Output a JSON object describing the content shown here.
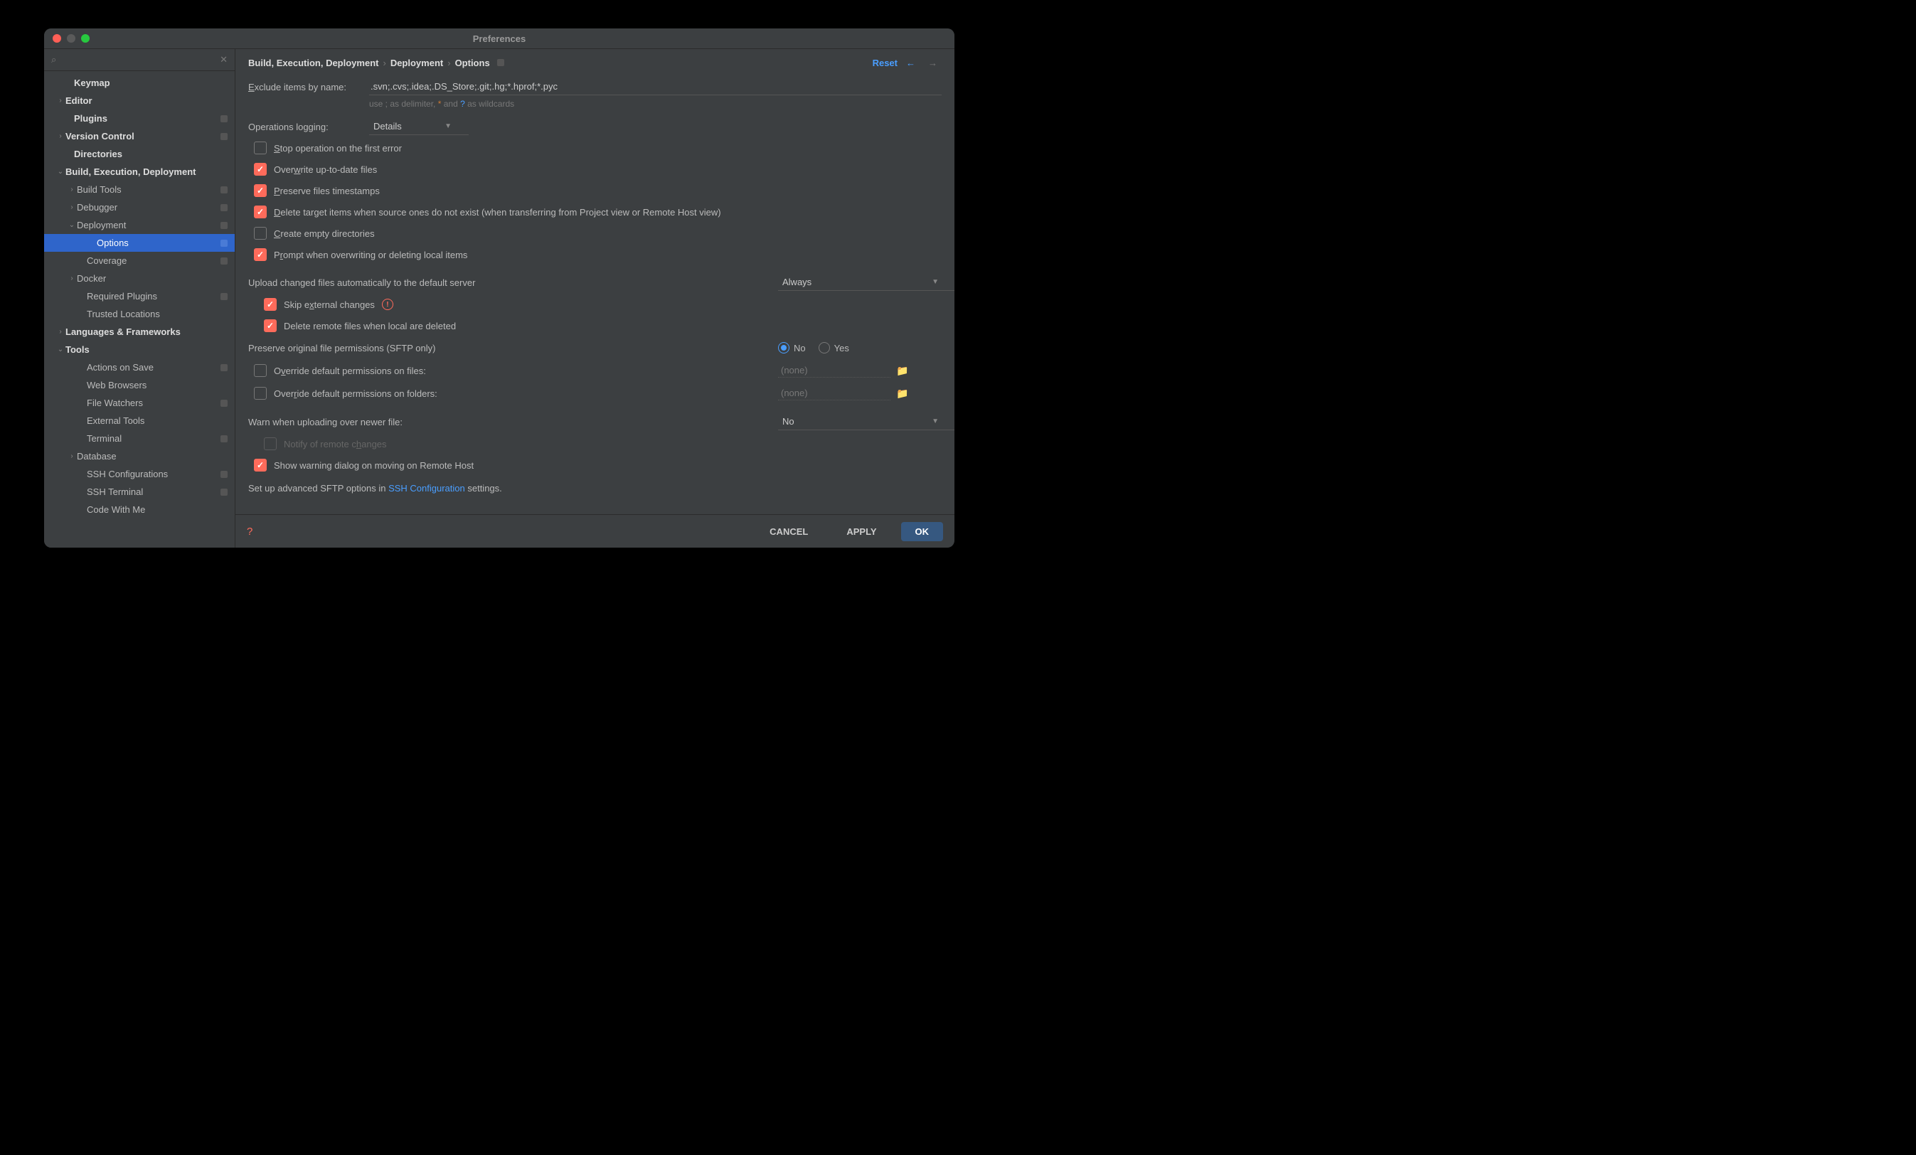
{
  "window_title": "Preferences",
  "search_placeholder": "",
  "sidebar": [
    {
      "label": "Keymap",
      "indent": 28,
      "bold": true,
      "arrow": "",
      "badge": false
    },
    {
      "label": "Editor",
      "indent": 16,
      "bold": true,
      "arrow": "›",
      "badge": false
    },
    {
      "label": "Plugins",
      "indent": 28,
      "bold": true,
      "arrow": "",
      "badge": true
    },
    {
      "label": "Version Control",
      "indent": 16,
      "bold": true,
      "arrow": "›",
      "badge": true
    },
    {
      "label": "Directories",
      "indent": 28,
      "bold": true,
      "arrow": "",
      "badge": false
    },
    {
      "label": "Build, Execution, Deployment",
      "indent": 16,
      "bold": true,
      "arrow": "⌄",
      "badge": false
    },
    {
      "label": "Build Tools",
      "indent": 32,
      "bold": false,
      "arrow": "›",
      "badge": true
    },
    {
      "label": "Debugger",
      "indent": 32,
      "bold": false,
      "arrow": "›",
      "badge": true
    },
    {
      "label": "Deployment",
      "indent": 32,
      "bold": false,
      "arrow": "⌄",
      "badge": true
    },
    {
      "label": "Options",
      "indent": 60,
      "bold": false,
      "arrow": "",
      "badge": true,
      "selected": true
    },
    {
      "label": "Coverage",
      "indent": 46,
      "bold": false,
      "arrow": "",
      "badge": true
    },
    {
      "label": "Docker",
      "indent": 32,
      "bold": false,
      "arrow": "›",
      "badge": false
    },
    {
      "label": "Required Plugins",
      "indent": 46,
      "bold": false,
      "arrow": "",
      "badge": true
    },
    {
      "label": "Trusted Locations",
      "indent": 46,
      "bold": false,
      "arrow": "",
      "badge": false
    },
    {
      "label": "Languages & Frameworks",
      "indent": 16,
      "bold": true,
      "arrow": "›",
      "badge": false
    },
    {
      "label": "Tools",
      "indent": 16,
      "bold": true,
      "arrow": "⌄",
      "badge": false
    },
    {
      "label": "Actions on Save",
      "indent": 46,
      "bold": false,
      "arrow": "",
      "badge": true
    },
    {
      "label": "Web Browsers",
      "indent": 46,
      "bold": false,
      "arrow": "",
      "badge": false
    },
    {
      "label": "File Watchers",
      "indent": 46,
      "bold": false,
      "arrow": "",
      "badge": true
    },
    {
      "label": "External Tools",
      "indent": 46,
      "bold": false,
      "arrow": "",
      "badge": false
    },
    {
      "label": "Terminal",
      "indent": 46,
      "bold": false,
      "arrow": "",
      "badge": true
    },
    {
      "label": "Database",
      "indent": 32,
      "bold": false,
      "arrow": "›",
      "badge": false
    },
    {
      "label": "SSH Configurations",
      "indent": 46,
      "bold": false,
      "arrow": "",
      "badge": true
    },
    {
      "label": "SSH Terminal",
      "indent": 46,
      "bold": false,
      "arrow": "",
      "badge": true
    },
    {
      "label": "Code With Me",
      "indent": 46,
      "bold": false,
      "arrow": "",
      "badge": false
    }
  ],
  "breadcrumbs": [
    "Build, Execution, Deployment",
    "Deployment",
    "Options"
  ],
  "reset_label": "Reset",
  "form": {
    "exclude_label": "Exclude items by name:",
    "exclude_value": ".svn;.cvs;.idea;.DS_Store;.git;.hg;*.hprof;*.pyc",
    "exclude_hint_pre": "use ; as delimiter, ",
    "exclude_hint_star": "*",
    "exclude_hint_mid": " and ",
    "exclude_hint_q": "?",
    "exclude_hint_post": " as wildcards",
    "oplog_label": "Operations logging:",
    "oplog_value": "Details",
    "chk_stop": "Stop operation on the first error",
    "chk_overwrite": "Overwrite up-to-date files",
    "chk_preserve_ts": "Preserve files timestamps",
    "chk_delete_target": "Delete target items when source ones do not exist (when transferring from Project view or Remote Host view)",
    "chk_create_empty": "Create empty directories",
    "chk_prompt": "Prompt when overwriting or deleting local items",
    "upload_label": "Upload changed files automatically to the default server",
    "upload_value": "Always",
    "chk_skip_ext": "Skip external changes",
    "chk_del_remote": "Delete remote files when local are deleted",
    "preserve_perm_label": "Preserve original file permissions (SFTP only)",
    "radio_no": "No",
    "radio_yes": "Yes",
    "chk_override_files": "Override default permissions on files:",
    "chk_override_folders": "Override default permissions on folders:",
    "perm_none": "(none)",
    "warn_label": "Warn when uploading over newer file:",
    "warn_value": "No",
    "chk_notify": "Notify of remote changes",
    "chk_show_warning": "Show warning dialog on moving on Remote Host",
    "footnote_pre": "Set up advanced SFTP options in ",
    "footnote_link": "SSH Configuration",
    "footnote_post": " settings."
  },
  "footer": {
    "cancel": "CANCEL",
    "apply": "APPLY",
    "ok": "OK"
  },
  "underlines": {
    "exclude": "E",
    "stop": "S",
    "overwrite": "w",
    "preserve": "P",
    "delete": "D",
    "create": "C",
    "prompt": "r",
    "skip": "x",
    "override_files": "v",
    "override_folders": "r",
    "notify": "h"
  }
}
